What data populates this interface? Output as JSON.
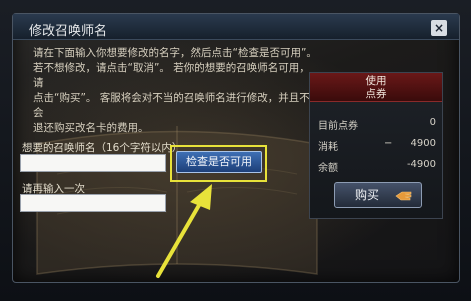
{
  "dialog": {
    "title": "修改召唤师名",
    "close_label": "×",
    "instructions": [
      "请在下面输入你想要修改的名字，然后点击“检查是否可用”。",
      "若不想修改，请点击“取消”。 若你的想要的召唤师名可用，请",
      "点击“购买”。 客服将会对不当的召唤师名进行修改，并且不会",
      "退还购买改名卡的费用。"
    ]
  },
  "form": {
    "name_label": "想要的召唤师名（16个字符以内）",
    "name_value": "",
    "confirm_label": "请再输入一次",
    "confirm_value": "",
    "check_button": "检查是否可用"
  },
  "points": {
    "header_line1": "使用",
    "header_line2": "点券",
    "rows": [
      {
        "label": "目前点券",
        "mark": "",
        "value": "0"
      },
      {
        "label": "消耗",
        "mark": "−",
        "value": "4900"
      },
      {
        "label": "余额",
        "mark": "",
        "value": "-4900"
      }
    ],
    "buy_button": "购买"
  },
  "annotation": {
    "highlight_color": "#e8e23a"
  }
}
